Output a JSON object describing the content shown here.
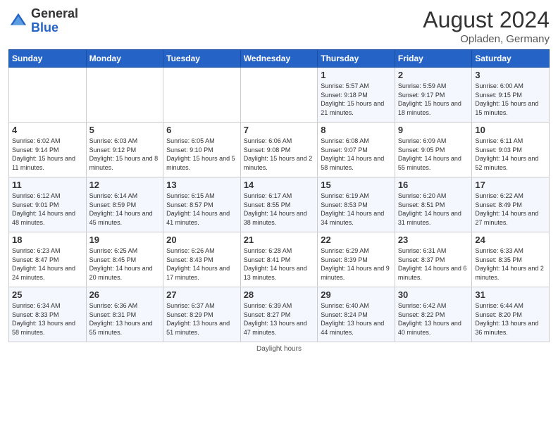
{
  "header": {
    "logo_general": "General",
    "logo_blue": "Blue",
    "month_title": "August 2024",
    "location": "Opladen, Germany"
  },
  "footer": {
    "note": "Daylight hours"
  },
  "weekdays": [
    "Sunday",
    "Monday",
    "Tuesday",
    "Wednesday",
    "Thursday",
    "Friday",
    "Saturday"
  ],
  "weeks": [
    [
      {
        "day": "",
        "sunrise": "",
        "sunset": "",
        "daylight": ""
      },
      {
        "day": "",
        "sunrise": "",
        "sunset": "",
        "daylight": ""
      },
      {
        "day": "",
        "sunrise": "",
        "sunset": "",
        "daylight": ""
      },
      {
        "day": "",
        "sunrise": "",
        "sunset": "",
        "daylight": ""
      },
      {
        "day": "1",
        "sunrise": "Sunrise: 5:57 AM",
        "sunset": "Sunset: 9:18 PM",
        "daylight": "Daylight: 15 hours and 21 minutes."
      },
      {
        "day": "2",
        "sunrise": "Sunrise: 5:59 AM",
        "sunset": "Sunset: 9:17 PM",
        "daylight": "Daylight: 15 hours and 18 minutes."
      },
      {
        "day": "3",
        "sunrise": "Sunrise: 6:00 AM",
        "sunset": "Sunset: 9:15 PM",
        "daylight": "Daylight: 15 hours and 15 minutes."
      }
    ],
    [
      {
        "day": "4",
        "sunrise": "Sunrise: 6:02 AM",
        "sunset": "Sunset: 9:14 PM",
        "daylight": "Daylight: 15 hours and 11 minutes."
      },
      {
        "day": "5",
        "sunrise": "Sunrise: 6:03 AM",
        "sunset": "Sunset: 9:12 PM",
        "daylight": "Daylight: 15 hours and 8 minutes."
      },
      {
        "day": "6",
        "sunrise": "Sunrise: 6:05 AM",
        "sunset": "Sunset: 9:10 PM",
        "daylight": "Daylight: 15 hours and 5 minutes."
      },
      {
        "day": "7",
        "sunrise": "Sunrise: 6:06 AM",
        "sunset": "Sunset: 9:08 PM",
        "daylight": "Daylight: 15 hours and 2 minutes."
      },
      {
        "day": "8",
        "sunrise": "Sunrise: 6:08 AM",
        "sunset": "Sunset: 9:07 PM",
        "daylight": "Daylight: 14 hours and 58 minutes."
      },
      {
        "day": "9",
        "sunrise": "Sunrise: 6:09 AM",
        "sunset": "Sunset: 9:05 PM",
        "daylight": "Daylight: 14 hours and 55 minutes."
      },
      {
        "day": "10",
        "sunrise": "Sunrise: 6:11 AM",
        "sunset": "Sunset: 9:03 PM",
        "daylight": "Daylight: 14 hours and 52 minutes."
      }
    ],
    [
      {
        "day": "11",
        "sunrise": "Sunrise: 6:12 AM",
        "sunset": "Sunset: 9:01 PM",
        "daylight": "Daylight: 14 hours and 48 minutes."
      },
      {
        "day": "12",
        "sunrise": "Sunrise: 6:14 AM",
        "sunset": "Sunset: 8:59 PM",
        "daylight": "Daylight: 14 hours and 45 minutes."
      },
      {
        "day": "13",
        "sunrise": "Sunrise: 6:15 AM",
        "sunset": "Sunset: 8:57 PM",
        "daylight": "Daylight: 14 hours and 41 minutes."
      },
      {
        "day": "14",
        "sunrise": "Sunrise: 6:17 AM",
        "sunset": "Sunset: 8:55 PM",
        "daylight": "Daylight: 14 hours and 38 minutes."
      },
      {
        "day": "15",
        "sunrise": "Sunrise: 6:19 AM",
        "sunset": "Sunset: 8:53 PM",
        "daylight": "Daylight: 14 hours and 34 minutes."
      },
      {
        "day": "16",
        "sunrise": "Sunrise: 6:20 AM",
        "sunset": "Sunset: 8:51 PM",
        "daylight": "Daylight: 14 hours and 31 minutes."
      },
      {
        "day": "17",
        "sunrise": "Sunrise: 6:22 AM",
        "sunset": "Sunset: 8:49 PM",
        "daylight": "Daylight: 14 hours and 27 minutes."
      }
    ],
    [
      {
        "day": "18",
        "sunrise": "Sunrise: 6:23 AM",
        "sunset": "Sunset: 8:47 PM",
        "daylight": "Daylight: 14 hours and 24 minutes."
      },
      {
        "day": "19",
        "sunrise": "Sunrise: 6:25 AM",
        "sunset": "Sunset: 8:45 PM",
        "daylight": "Daylight: 14 hours and 20 minutes."
      },
      {
        "day": "20",
        "sunrise": "Sunrise: 6:26 AM",
        "sunset": "Sunset: 8:43 PM",
        "daylight": "Daylight: 14 hours and 17 minutes."
      },
      {
        "day": "21",
        "sunrise": "Sunrise: 6:28 AM",
        "sunset": "Sunset: 8:41 PM",
        "daylight": "Daylight: 14 hours and 13 minutes."
      },
      {
        "day": "22",
        "sunrise": "Sunrise: 6:29 AM",
        "sunset": "Sunset: 8:39 PM",
        "daylight": "Daylight: 14 hours and 9 minutes."
      },
      {
        "day": "23",
        "sunrise": "Sunrise: 6:31 AM",
        "sunset": "Sunset: 8:37 PM",
        "daylight": "Daylight: 14 hours and 6 minutes."
      },
      {
        "day": "24",
        "sunrise": "Sunrise: 6:33 AM",
        "sunset": "Sunset: 8:35 PM",
        "daylight": "Daylight: 14 hours and 2 minutes."
      }
    ],
    [
      {
        "day": "25",
        "sunrise": "Sunrise: 6:34 AM",
        "sunset": "Sunset: 8:33 PM",
        "daylight": "Daylight: 13 hours and 58 minutes."
      },
      {
        "day": "26",
        "sunrise": "Sunrise: 6:36 AM",
        "sunset": "Sunset: 8:31 PM",
        "daylight": "Daylight: 13 hours and 55 minutes."
      },
      {
        "day": "27",
        "sunrise": "Sunrise: 6:37 AM",
        "sunset": "Sunset: 8:29 PM",
        "daylight": "Daylight: 13 hours and 51 minutes."
      },
      {
        "day": "28",
        "sunrise": "Sunrise: 6:39 AM",
        "sunset": "Sunset: 8:27 PM",
        "daylight": "Daylight: 13 hours and 47 minutes."
      },
      {
        "day": "29",
        "sunrise": "Sunrise: 6:40 AM",
        "sunset": "Sunset: 8:24 PM",
        "daylight": "Daylight: 13 hours and 44 minutes."
      },
      {
        "day": "30",
        "sunrise": "Sunrise: 6:42 AM",
        "sunset": "Sunset: 8:22 PM",
        "daylight": "Daylight: 13 hours and 40 minutes."
      },
      {
        "day": "31",
        "sunrise": "Sunrise: 6:44 AM",
        "sunset": "Sunset: 8:20 PM",
        "daylight": "Daylight: 13 hours and 36 minutes."
      }
    ]
  ]
}
